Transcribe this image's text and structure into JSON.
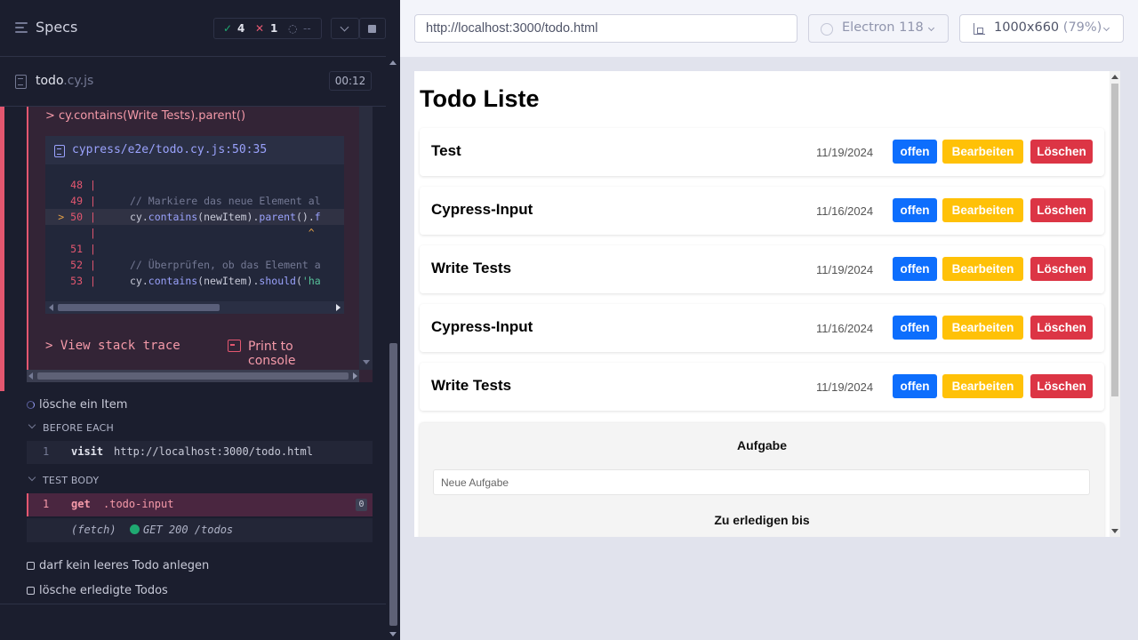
{
  "header": {
    "title": "Specs",
    "passed_icon": "✓",
    "passed": "4",
    "failed_icon": "✕",
    "failed": "1",
    "pending": "--"
  },
  "spec_file": {
    "name": "todo",
    "ext": ".cy.js",
    "duration": "00:12"
  },
  "error": {
    "command": "> cy.contains(Write Tests).parent()",
    "file_path": "cypress/e2e/todo.cy.js:50:35",
    "code_lines": [
      {
        "num": "48",
        "marker": "",
        "code": ""
      },
      {
        "num": "49",
        "marker": "",
        "code": "// Markiere das neue Element al"
      },
      {
        "num": "50",
        "marker": ">",
        "code_parts": [
          "cy.",
          "contains",
          "(newItem).",
          "parent",
          "().",
          "f"
        ]
      },
      {
        "num": "",
        "marker": "",
        "code": "                             ^"
      },
      {
        "num": "51",
        "marker": "",
        "code": ""
      },
      {
        "num": "52",
        "marker": "",
        "code": "// Überprüfen, ob das Element a"
      },
      {
        "num": "53",
        "marker": "",
        "code_parts": [
          "cy.",
          "contains",
          "(newItem).",
          "should",
          "(",
          "'ha"
        ]
      }
    ],
    "view_stack_trace": "> View stack trace",
    "print_to_console": "Print to console"
  },
  "tests": {
    "active_test": "lösche ein Item",
    "before_each_label": "BEFORE EACH",
    "visit_cmd": {
      "num": "1",
      "name": "visit",
      "message": "http://localhost:3000/todo.html"
    },
    "test_body_label": "TEST BODY",
    "get_cmd": {
      "num": "1",
      "name": "get",
      "message": ".todo-input",
      "badge": "0"
    },
    "fetch_cmd": {
      "type": "(fetch)",
      "message": "GET 200 /todos"
    },
    "other_tests": [
      "darf kein leeres Todo anlegen",
      "lösche erledigte Todos"
    ]
  },
  "browser_bar": {
    "url": "http://localhost:3000/todo.html",
    "browser": "Electron 118",
    "viewport": "1000x660",
    "zoom": "(79%)"
  },
  "app": {
    "title": "Todo Liste",
    "todos": [
      {
        "title": "Test",
        "date": "11/19/2024"
      },
      {
        "title": "Cypress-Input",
        "date": "11/16/2024"
      },
      {
        "title": "Write Tests",
        "date": "11/19/2024"
      },
      {
        "title": "Cypress-Input",
        "date": "11/16/2024"
      },
      {
        "title": "Write Tests",
        "date": "11/19/2024"
      }
    ],
    "status_label": "offen",
    "edit_label": "Bearbeiten",
    "delete_label": "Löschen",
    "form": {
      "task_label": "Aufgabe",
      "task_placeholder": "Neue Aufgabe",
      "due_label": "Zu erledigen bis"
    }
  },
  "colors": {
    "pass": "#1fa971",
    "fail": "#e45770",
    "btn_open": "#0d6efd",
    "btn_edit": "#ffc107",
    "btn_delete": "#dc3545"
  }
}
